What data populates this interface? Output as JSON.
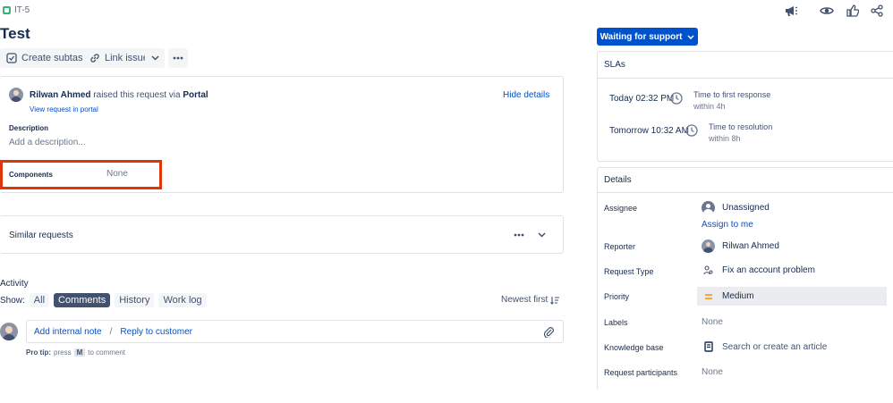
{
  "issue": {
    "key": "IT-5",
    "title": "Test"
  },
  "toolbar": {
    "create_subtask": "Create subtask",
    "link_issue": "Link issue"
  },
  "request": {
    "reporter_name": "Rilwan Ahmed",
    "raised_text": "raised this request via",
    "channel": "Portal",
    "view_link": "View request in portal",
    "hide_details": "Hide details"
  },
  "description": {
    "label": "Description",
    "placeholder": "Add a description..."
  },
  "components": {
    "label": "Components",
    "value": "None"
  },
  "similar": {
    "label": "Similar requests"
  },
  "activity": {
    "title": "Activity",
    "show_label": "Show:",
    "tabs": [
      "All",
      "Comments",
      "History",
      "Work log"
    ],
    "sort": "Newest first",
    "add_internal": "Add internal note",
    "separator": "/",
    "reply": "Reply to customer",
    "pro_tip_label": "Pro tip:",
    "pro_tip_press": "press",
    "pro_tip_key": "M",
    "pro_tip_rest": "to comment"
  },
  "status": {
    "label": "Waiting for support"
  },
  "slas": {
    "title": "SLAs",
    "items": [
      {
        "time": "Today 02:32 PM",
        "name": "Time to first response",
        "within": "within 4h"
      },
      {
        "time": "Tomorrow 10:32 AM",
        "name": "Time to resolution",
        "within": "within 8h"
      }
    ]
  },
  "details": {
    "title": "Details",
    "assignee_label": "Assignee",
    "assignee_value": "Unassigned",
    "assign_to_me": "Assign to me",
    "reporter_label": "Reporter",
    "reporter_value": "Rilwan Ahmed",
    "request_type_label": "Request Type",
    "request_type_value": "Fix an account problem",
    "priority_label": "Priority",
    "priority_value": "Medium",
    "labels_label": "Labels",
    "labels_value": "None",
    "kb_label": "Knowledge base",
    "kb_value": "Search or create an article",
    "participants_label": "Request participants",
    "participants_value": "None"
  },
  "colors": {
    "primary": "#0052cc",
    "highlight_border": "#de350b",
    "priority": "#ff991f",
    "issue_icon": "#36b37e"
  }
}
